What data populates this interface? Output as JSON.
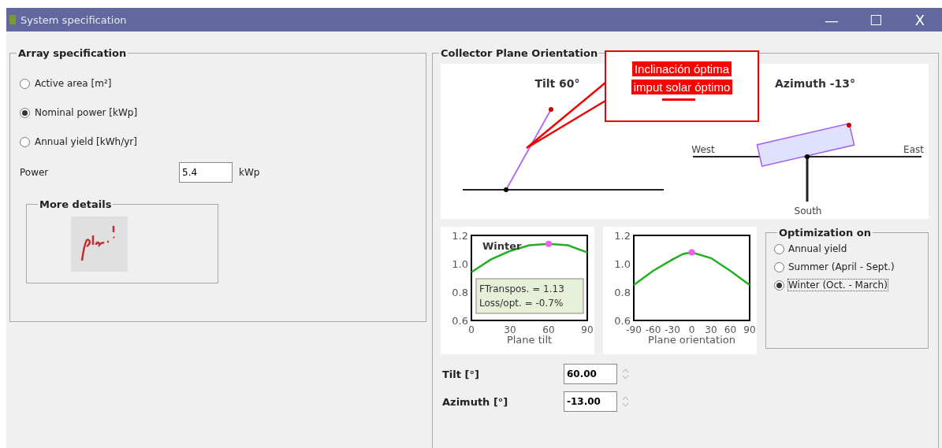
{
  "window": {
    "title": "System specification",
    "controls": [
      "—",
      "☐",
      "X"
    ]
  },
  "array_specification": {
    "title": "Array specification",
    "options": [
      {
        "label": "Active area [m²]",
        "selected": false
      },
      {
        "label": "Nominal power [kWp]",
        "selected": true
      },
      {
        "label": "Annual yield [kWh/yr]",
        "selected": false
      }
    ],
    "power": {
      "label": "Power",
      "value": "5.4",
      "unit": "kWp"
    },
    "more_details": {
      "title": "More details"
    }
  },
  "orientation": {
    "title": "Collector Plane Orientation",
    "tilt_caption": "Tilt 60°",
    "azimuth_caption": "Azimuth -13°",
    "west": "West",
    "east": "East",
    "south": "South"
  },
  "callout": {
    "lines": [
      "Inclinación óptima",
      "imput solar óptimo"
    ]
  },
  "tilt_chart": {
    "info": [
      "FTranspos. = 1.13",
      "Loss/opt. = -0.7%"
    ],
    "chart_data": {
      "type": "line",
      "xlabel": "Plane tilt",
      "x": [
        0,
        15,
        30,
        45,
        60,
        75,
        90
      ],
      "series": [
        {
          "name": "Winter",
          "color": "#22b022",
          "values": [
            0.94,
            1.03,
            1.09,
            1.13,
            1.14,
            1.13,
            1.08
          ]
        }
      ],
      "xlim": [
        0,
        90
      ],
      "ylim": [
        0.6,
        1.2
      ],
      "xticks": [
        0,
        30,
        60,
        90
      ],
      "yticks": [
        {
          "value": 0.6,
          "label": "0.6"
        },
        {
          "value": 0.8,
          "label": "0.8"
        },
        {
          "value": 1,
          "label": "1.0"
        },
        {
          "value": 1.2,
          "label": "1.2"
        }
      ]
    }
  },
  "azimuth_chart": {
    "chart_data": {
      "type": "line",
      "xlabel": "Plane orientation",
      "x": [
        -90,
        -60,
        -30,
        -13,
        0,
        30,
        60,
        90
      ],
      "series": [
        {
          "color": "#22b022",
          "values": [
            0.85,
            0.95,
            1.03,
            1.07,
            1.08,
            1.04,
            0.95,
            0.85
          ]
        }
      ],
      "xlim": [
        -90,
        90
      ],
      "ylim": [
        0.6,
        1.2
      ],
      "xticks": [
        -90,
        -60,
        -30,
        0,
        30,
        60,
        90
      ],
      "yticks": [
        {
          "value": 0.6,
          "label": "0.6"
        },
        {
          "value": 0.8,
          "label": "0.8"
        },
        {
          "value": 1,
          "label": "1.0"
        },
        {
          "value": 1.2,
          "label": "1.2"
        }
      ]
    }
  },
  "optimization": {
    "title": "Optimization on",
    "options": [
      {
        "label": "Annual yield",
        "selected": false
      },
      {
        "label": "Summer (April - Sept.)",
        "selected": false
      },
      {
        "label": "Winter (Oct. - March)",
        "selected": true
      }
    ]
  },
  "fields": [
    {
      "label": "Tilt [°]",
      "value": "60.00"
    },
    {
      "label": "Azimuth [°]",
      "value": "-13.00"
    }
  ]
}
